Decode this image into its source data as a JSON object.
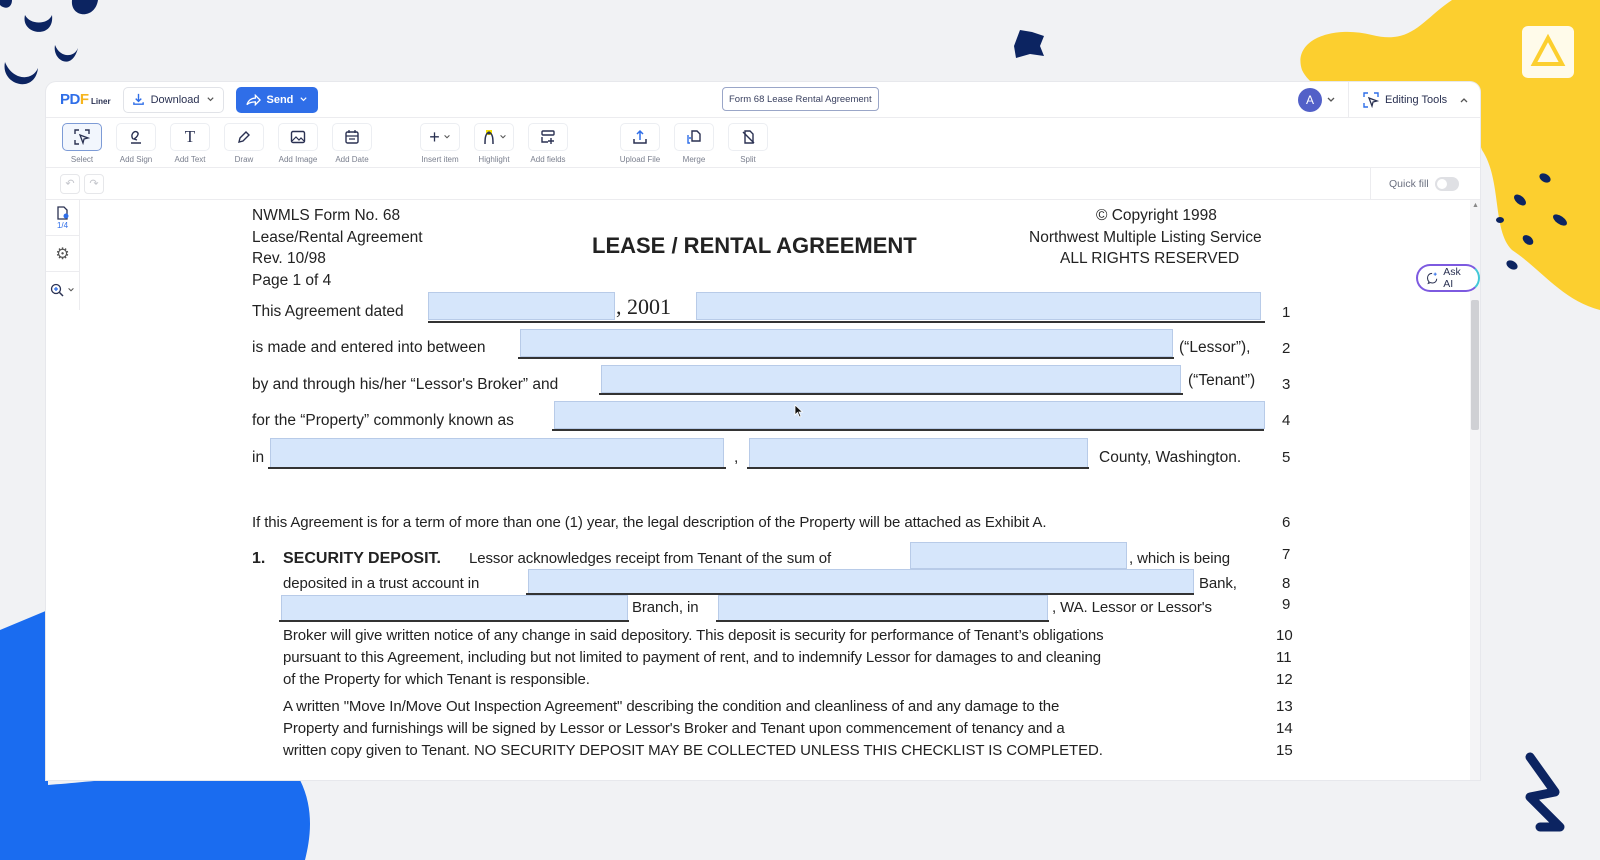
{
  "app": {
    "brand": {
      "part1": "PD",
      "part2": "F",
      "part3": "Liner"
    },
    "download_label": "Download",
    "send_label": "Send",
    "document_title": "Form 68 Lease Rental Agreement",
    "avatar_initial": "A",
    "editing_tools_label": "Editing Tools",
    "quick_fill_label": "Quick fill",
    "quick_fill_on": false,
    "page_counter": "1/4",
    "ask_ai_label": "Ask AI",
    "colors": {
      "accent": "#2f6ee8",
      "field_fill": "#d6e6fb",
      "avatar": "#5260c8",
      "deco_yellow": "#fccf2f",
      "deco_blue": "#1a6cf0",
      "deco_navy": "#0c2461"
    }
  },
  "toolbar": [
    {
      "id": "select",
      "label": "Select",
      "icon": "select-cursor-icon",
      "active": true
    },
    {
      "id": "add-sign",
      "label": "Add Sign",
      "icon": "signature-icon"
    },
    {
      "id": "add-text",
      "label": "Add Text",
      "icon": "text-icon"
    },
    {
      "id": "draw",
      "label": "Draw",
      "icon": "pen-icon"
    },
    {
      "id": "add-image",
      "label": "Add Image",
      "icon": "image-icon"
    },
    {
      "id": "add-date",
      "label": "Add Date",
      "icon": "calendar-icon"
    },
    {
      "id": "insert-item",
      "label": "Insert item",
      "icon": "plus-icon"
    },
    {
      "id": "highlight",
      "label": "Highlight",
      "icon": "highlighter-icon"
    },
    {
      "id": "add-fields",
      "label": "Add fields",
      "icon": "add-fields-icon"
    },
    {
      "id": "upload-file",
      "label": "Upload File",
      "icon": "upload-icon"
    },
    {
      "id": "merge",
      "label": "Merge",
      "icon": "merge-icon"
    },
    {
      "id": "split",
      "label": "Split",
      "icon": "split-icon"
    }
  ],
  "document": {
    "header_left": [
      "NWMLS Form No. 68",
      "Lease/Rental Agreement",
      "Rev. 10/98",
      "Page 1 of 4"
    ],
    "title": "LEASE / RENTAL AGREEMENT",
    "header_right": [
      "© Copyright 1998",
      "Northwest Multiple Listing Service",
      "ALL RIGHTS RESERVED"
    ],
    "lines": {
      "l1_label": "This Agreement dated",
      "l1_year": ",  2001",
      "l2_label": "is made and entered into between",
      "l2_suffix": "(“Lessor”),",
      "l3_label": "by and through his/her “Lessor's Broker” and",
      "l3_suffix": "(“Tenant”)",
      "l4_label": "for the “Property” commonly known as",
      "l5_label": "in",
      "l5_comma": ",",
      "l5_suffix": "County, Washington.",
      "l6": "If this Agreement is for a term of more than one (1) year, the legal description of the Property will be attached as Exhibit A.",
      "s1_num": "1.",
      "s1_head": "SECURITY DEPOSIT.",
      "l7_text": "Lessor acknowledges receipt from Tenant of the sum of",
      "l7_suffix": ", which is being",
      "l8_label": "deposited in a trust account in",
      "l8_suffix": "Bank,",
      "l9_mid": "Branch, in",
      "l9_suffix": ", WA.  Lessor or Lessor's",
      "l10": "Broker will give written notice of any change in said depository. This deposit is security for performance of Tenant’s obligations",
      "l11": "pursuant to this Agreement, including but not limited to payment of rent, and to indemnify Lessor for damages to and cleaning",
      "l12": "of the Property for which Tenant is responsible.",
      "l13": "A written \"Move In/Move Out Inspection Agreement\" describing the condition and cleanliness of and any damage to the",
      "l14": "Property and furnishings will be signed by Lessor or Lessor's Broker and Tenant upon commencement of tenancy and a",
      "l15": "written copy given to Tenant.  NO SECURITY DEPOSIT MAY BE COLLECTED UNLESS THIS CHECKLIST IS COMPLETED."
    },
    "line_numbers": [
      "1",
      "2",
      "3",
      "4",
      "5",
      "6",
      "7",
      "8",
      "9",
      "10",
      "11",
      "12",
      "13",
      "14",
      "15"
    ],
    "fields": {
      "date": "",
      "date_continued": "",
      "lessor": "",
      "tenant": "",
      "property": "",
      "city": "",
      "county": "",
      "deposit_sum": "",
      "bank": "",
      "branch": "",
      "branch_city": ""
    }
  }
}
